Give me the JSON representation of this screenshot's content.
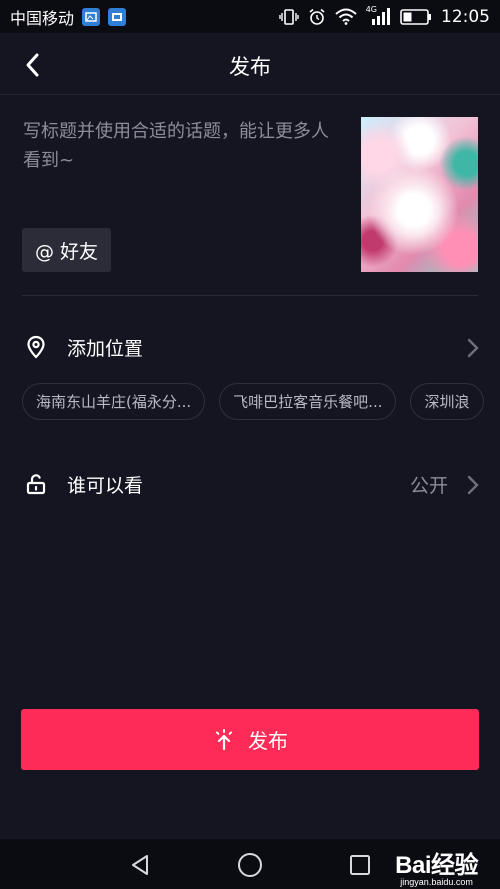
{
  "status_bar": {
    "carrier": "中国移动",
    "network": "4G",
    "time": "12:05"
  },
  "header": {
    "title": "发布",
    "back_icon": "chevron-left-icon"
  },
  "caption": {
    "placeholder": "写标题并使用合适的话题，能让更多人看到~"
  },
  "mention": {
    "label": "@ 好友"
  },
  "location": {
    "label": "添加位置",
    "icon": "location-pin-icon",
    "suggestions": [
      "海南东山羊庄(福永分...",
      "飞啡巴拉客音乐餐吧...",
      "深圳浪"
    ]
  },
  "visibility": {
    "label": "谁可以看",
    "value": "公开",
    "icon": "unlock-icon"
  },
  "publish": {
    "label": "发布",
    "icon": "sparkle-arrow-up-icon"
  },
  "watermark": {
    "main": "Bai经验",
    "sub": "jingyan.baidu.com"
  },
  "colors": {
    "background": "#151522",
    "accent": "#fd2b55",
    "muted_text": "#8d8d9a"
  }
}
